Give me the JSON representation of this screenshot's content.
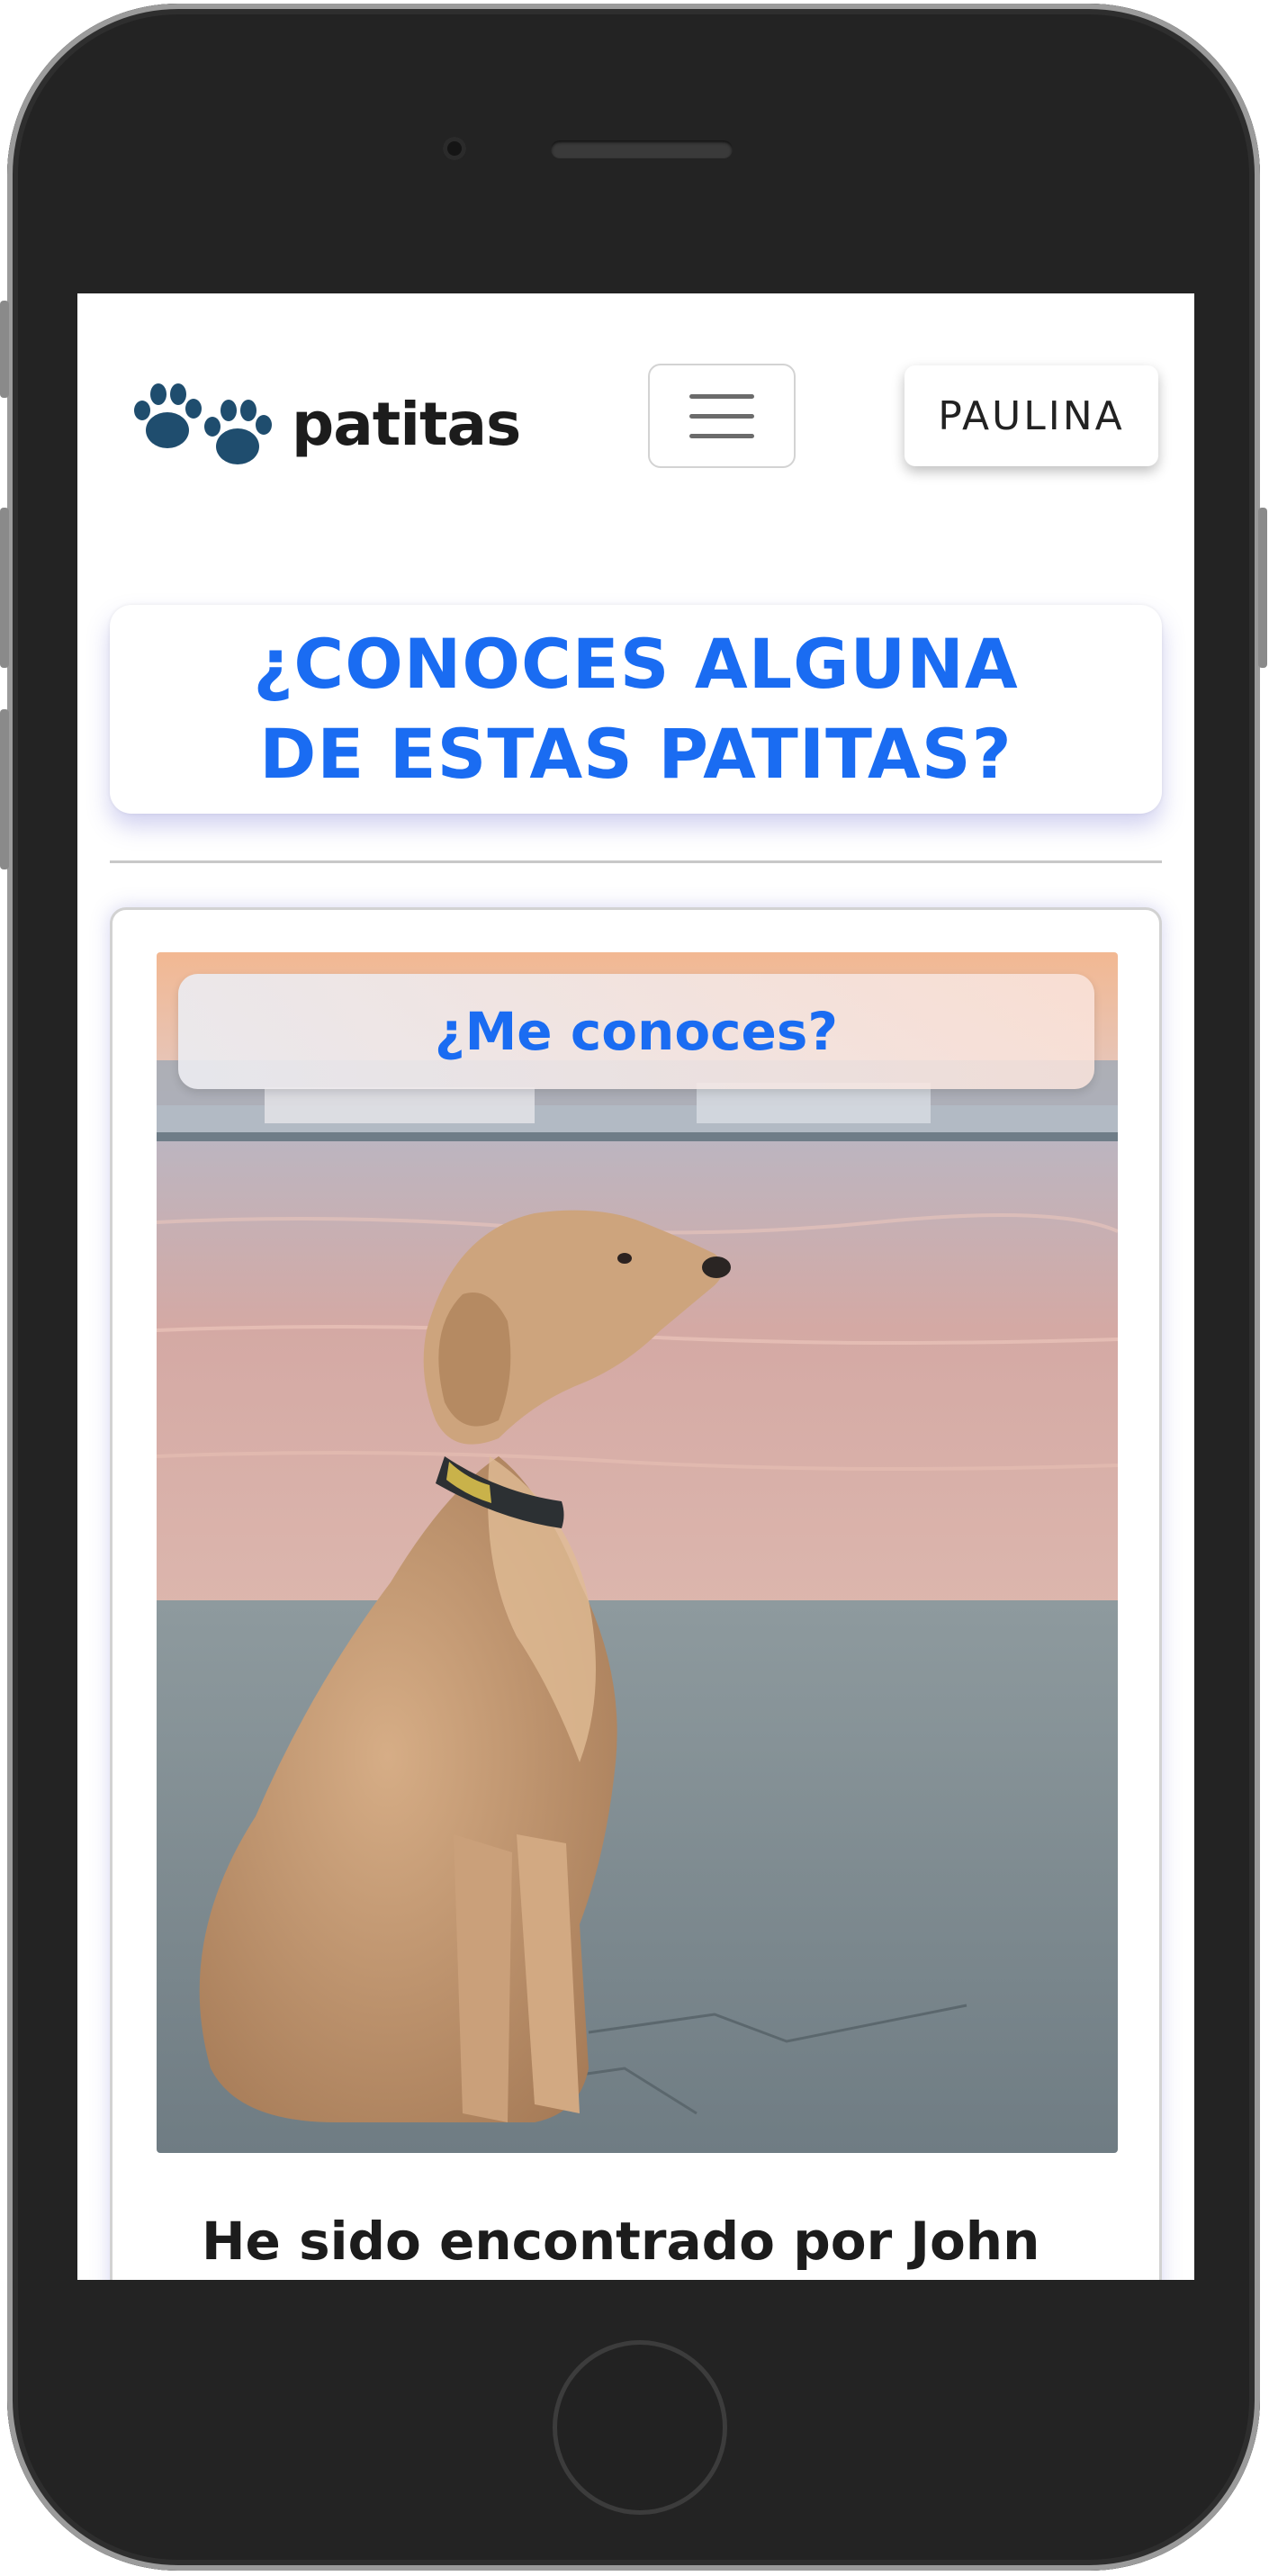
{
  "navbar": {
    "brand_name": "patitas",
    "brand_icon": "paw-prints-icon",
    "menu_icon": "hamburger-menu-icon",
    "user_label": "PAULINA"
  },
  "main": {
    "title": "¿CONOCES ALGUNA DE ESTAS PATITAS?",
    "pet_card": {
      "badge": "¿Me conoces?",
      "photo_subject": "golden-retriever-photo",
      "found_text": "He sido encontrado por John"
    }
  },
  "colors": {
    "accent": "#1a6cf2",
    "brand_icon": "#1f4d6e",
    "device_frame": "#232323"
  }
}
